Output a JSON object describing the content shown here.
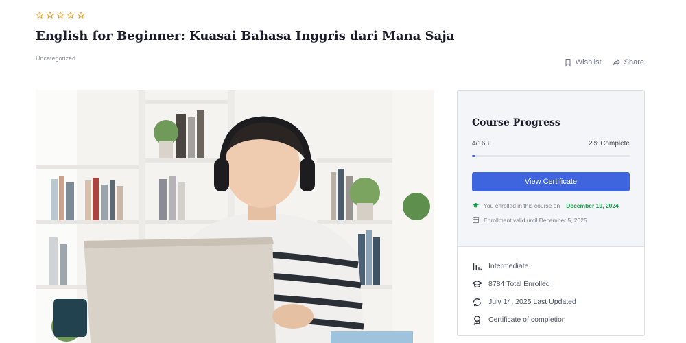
{
  "course": {
    "rating_stars": 0,
    "rating_max": 5,
    "title": "English for Beginner: Kuasai Bahasa Inggris dari Mana Saja",
    "category": "Uncategorized"
  },
  "actions": {
    "wishlist_label": "Wishlist",
    "share_label": "Share"
  },
  "hero_image": {
    "subject": "young man with headphones using laptop in front of bookshelves"
  },
  "progress_card": {
    "title": "Course Progress",
    "lessons_completed": "4/163",
    "percent_label": "2% Complete",
    "percent_value": 0.02,
    "button_label": "View Certificate",
    "enrolled_text": "You enrolled in this course on",
    "enrolled_date": "December 10, 2024",
    "validity_text": "Enrollment valid until December 5, 2025"
  },
  "course_meta": {
    "level": "Intermediate",
    "enrolled": "8784 Total Enrolled",
    "updated": "July 14, 2025 Last Updated",
    "certificate": "Certificate of completion"
  },
  "colors": {
    "accent": "#3e64de",
    "star": "#e8a33c",
    "success": "#1a9e4a"
  }
}
